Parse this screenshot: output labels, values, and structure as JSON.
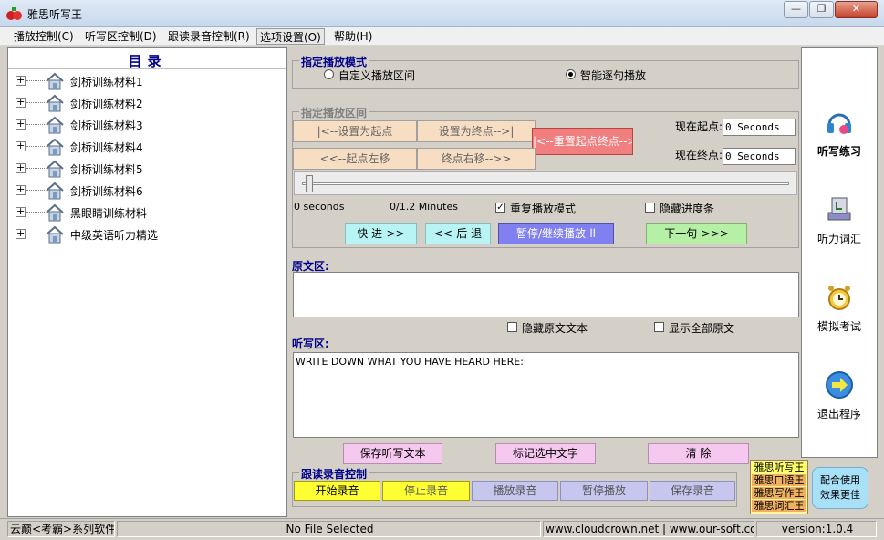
{
  "window": {
    "title": "雅思听写王",
    "minimize": "—",
    "restore": "❐",
    "close": "✕"
  },
  "menu": [
    {
      "label": "播放控制(C)"
    },
    {
      "label": "听写区控制(D)"
    },
    {
      "label": "跟读录音控制(R)"
    },
    {
      "label": "选项设置(O)"
    },
    {
      "label": "帮助(H)"
    }
  ],
  "tree": {
    "title": "目录",
    "items": [
      "剑桥训练材料1",
      "剑桥训练材料2",
      "剑桥训练材料3",
      "剑桥训练材料4",
      "剑桥训练材料5",
      "剑桥训练材料6",
      "黑眼睛训练材料",
      "中级英语听力精选"
    ]
  },
  "play_mode": {
    "legend": "指定播放模式",
    "custom_label": "自定义播放区间",
    "smart_label": "智能逐句播放",
    "selected": "smart"
  },
  "range": {
    "legend": "指定播放区间",
    "set_start": "|<--设置为起点",
    "set_end": "设置为终点-->|",
    "reset": "|<--重置起点终点-->|",
    "start_left": "<<--起点左移",
    "end_right": "终点右移-->>",
    "start_label": "现在起点:",
    "start_value": "0 Seconds",
    "end_label": "现在终点:",
    "end_value": "0 Seconds"
  },
  "playback": {
    "position": "0 seconds",
    "duration": "0/1.2 Minutes",
    "repeat_label": "重复播放模式",
    "repeat_checked": true,
    "hide_progress_label": "隐藏进度条",
    "hide_progress_checked": false,
    "forward": "快 进->>",
    "back": "<<-后 退",
    "pause": "暂停/继续播放-ll",
    "next": "下一句->>>",
    "progress_fraction": 0
  },
  "original": {
    "label": "原文区:",
    "text": "",
    "hide_label": "隐藏原文文本",
    "show_all_label": "显示全部原文"
  },
  "dictation": {
    "label": "听写区:",
    "text": "WRITE DOWN WHAT YOU HAVE HEARD HERE:",
    "save": "保存听写文本",
    "mark": "标记选中文字",
    "clear": "清 除"
  },
  "recording": {
    "legend": "跟读录音控制",
    "start": "开始录音",
    "stop": "停止录音",
    "play": "播放录音",
    "pause": "暂停播放",
    "save": "保存录音"
  },
  "sidebar": [
    {
      "label": "听写练习",
      "icon": "headphones-icon",
      "active": true
    },
    {
      "label": "听力词汇",
      "icon": "vocabulary-book-icon",
      "active": false
    },
    {
      "label": "模拟考试",
      "icon": "alarm-clock-icon",
      "active": false
    },
    {
      "label": "退出程序",
      "icon": "exit-arrow-icon",
      "active": false
    }
  ],
  "promo": {
    "lines": [
      "雅思听写王",
      "雅思口语王",
      "雅思写作王",
      "雅思词汇王"
    ],
    "combo": "配合使用\n效果更佳"
  },
  "status": {
    "brand": "云巅<考霸>系列软件",
    "file": "No File Selected",
    "site": "www.cloudcrown.net | www.our-soft.com",
    "version": "version:1.0.4"
  },
  "colors": {
    "legend_blue": "#00008b",
    "reset_btn": "#f08080",
    "pause_btn": "#8080f0",
    "next_btn": "#b5f0a6",
    "record_btn": "#ffff33"
  }
}
